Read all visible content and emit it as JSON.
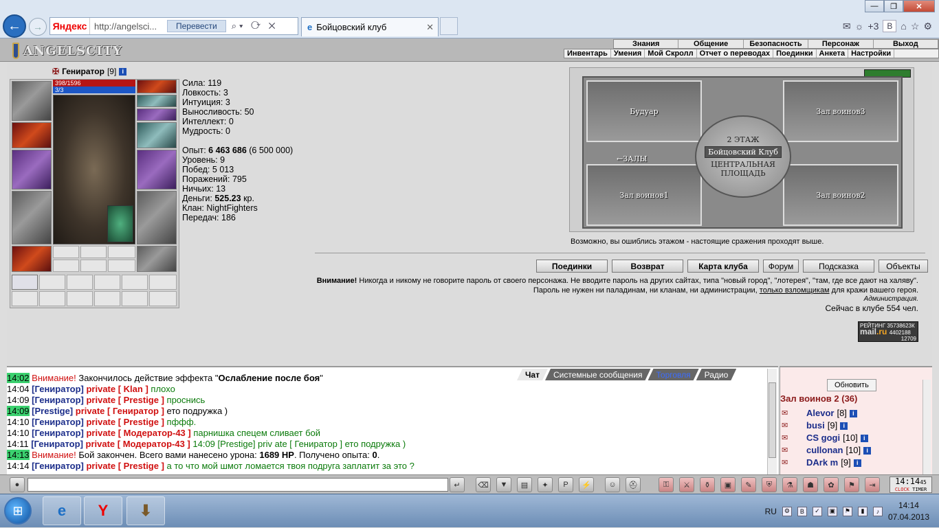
{
  "browser": {
    "search_engine": "Яндекс",
    "url": "http://angelsci...",
    "translate_label": "Перевести",
    "tab_title": "Бойцовский клуб",
    "notify_count": "+3"
  },
  "game": {
    "logo": "ANGELSCITY",
    "main_menu": [
      "Знания",
      "Общение",
      "Безопасность",
      "Персонаж",
      "Выход"
    ],
    "sub_menu": [
      "Инвентарь",
      "Умения",
      "Мой Скролл",
      "Отчет о переводах",
      "Поединки",
      "Анкета",
      "Настройки"
    ]
  },
  "character": {
    "name": "Гениратор",
    "level": "[9]",
    "hp": "398/1596",
    "mp": "3/3",
    "stats": [
      {
        "label": "Сила:",
        "value": "119"
      },
      {
        "label": "Ловкость:",
        "value": "3"
      },
      {
        "label": "Интуиция:",
        "value": "3"
      },
      {
        "label": "Выносливость:",
        "value": "50"
      },
      {
        "label": "Интеллект:",
        "value": "0"
      },
      {
        "label": "Мудрость:",
        "value": "0"
      }
    ],
    "exp_label": "Опыт:",
    "exp_value": "6 463 686",
    "exp_next": "(6 500 000)",
    "details": [
      {
        "label": "Уровень:",
        "value": "9"
      },
      {
        "label": "Побед:",
        "value": "5 013"
      },
      {
        "label": "Поражений:",
        "value": "795"
      },
      {
        "label": "Ничьих:",
        "value": "13"
      }
    ],
    "money_label": "Деньги:",
    "money_value": "525.23",
    "money_unit": "кр.",
    "clan_label": "Клан:",
    "clan_value": "NightFighters",
    "transfers_label": "Передач:",
    "transfers_value": "186"
  },
  "map": {
    "rooms": [
      "Будуар",
      "Зал воинов3",
      "Зал воинов1",
      "Зал воинов2"
    ],
    "hub_floor": "2 ЭТАЖ",
    "hub_club": "Бойцовский Клуб",
    "hub_square": "ЦЕНТРАЛЬНАЯ ПЛОЩАДЬ",
    "halls": "←ЗАЛЫ",
    "hint": "Возможно, вы ошиблись этажом - настоящие сражения проходят выше."
  },
  "actions": [
    "Поединки",
    "Возврат",
    "Карта клуба",
    "Форум",
    "Подсказка",
    "Объекты"
  ],
  "warning": {
    "bold": "Внимание!",
    "text1": " Никогда и никому не говорите пароль от своего персонажа. Не вводите пароль на других сайтах, типа \"новый город\", \"лотерея\", \"там, где все дают на халяву\". Пароль не нужен ни паладинам, ни кланам, ни администрации, ",
    "link": "только взломщикам",
    "text2": " для кражи вашего героя.",
    "admin": "Администрация.",
    "online": "Сейчас в клубе 554 чел."
  },
  "counter": {
    "line1": "РЕЙТИНГ 35738623К",
    "brand_a": "mail",
    "brand_b": ".ru",
    "line2": "4402188",
    "line3": "12709"
  },
  "chat": {
    "tabs": [
      "Чат",
      "Системные сообщения",
      "Торговля",
      "Радио"
    ],
    "messages": [
      {
        "time": "14:02",
        "hl": true,
        "parts": [
          {
            "c": "red",
            "t": "Внимание! "
          },
          {
            "c": "",
            "t": "Закончилось действие эффекта \""
          },
          {
            "c": "b",
            "t": "Ослабление после боя"
          },
          {
            "c": "",
            "t": "\""
          }
        ]
      },
      {
        "time": "14:04",
        "hl": false,
        "parts": [
          {
            "c": "nick",
            "t": "[Гениратор]"
          },
          {
            "c": "priv",
            "t": " private [ Klan ] "
          },
          {
            "c": "green",
            "t": "плохо"
          }
        ]
      },
      {
        "time": "14:09",
        "hl": false,
        "parts": [
          {
            "c": "nick",
            "t": "[Гениратор]"
          },
          {
            "c": "priv",
            "t": " private [ Prestige ] "
          },
          {
            "c": "green",
            "t": "проснись"
          }
        ]
      },
      {
        "time": "14:09",
        "hl": true,
        "parts": [
          {
            "c": "nick",
            "t": "[Prestige]"
          },
          {
            "c": "priv",
            "t": " private [ Гениратор ] "
          },
          {
            "c": "",
            "t": "ето подружка )"
          }
        ]
      },
      {
        "time": "14:10",
        "hl": false,
        "parts": [
          {
            "c": "nick",
            "t": "[Гениратор]"
          },
          {
            "c": "priv",
            "t": " private [ Prestige ] "
          },
          {
            "c": "green",
            "t": "пффф."
          }
        ]
      },
      {
        "time": "14:10",
        "hl": false,
        "parts": [
          {
            "c": "nick",
            "t": "[Гениратор]"
          },
          {
            "c": "priv",
            "t": " private [ Модератор-43 ] "
          },
          {
            "c": "green",
            "t": "парнишка спецем сливает бой"
          }
        ]
      },
      {
        "time": "14:11",
        "hl": false,
        "parts": [
          {
            "c": "nick",
            "t": "[Гениратор]"
          },
          {
            "c": "priv",
            "t": " private [ Модератор-43 ] "
          },
          {
            "c": "green",
            "t": "14:09 [Prestige] priv ate [ Гениратор ] ето подружка )"
          }
        ]
      },
      {
        "time": "14:13",
        "hl": true,
        "parts": [
          {
            "c": "red",
            "t": "Внимание! "
          },
          {
            "c": "",
            "t": "Бой закончен. Всего вами нанесено урона: "
          },
          {
            "c": "b",
            "t": "1689 HP"
          },
          {
            "c": "",
            "t": ". Получено опыта: "
          },
          {
            "c": "b",
            "t": "0"
          },
          {
            "c": "",
            "t": "."
          }
        ]
      },
      {
        "time": "14:14",
        "hl": false,
        "parts": [
          {
            "c": "nick",
            "t": "[Гениратор]"
          },
          {
            "c": "priv",
            "t": " private [ Prestige ] "
          },
          {
            "c": "green",
            "t": "а то что мой шмот ломается твоя подруга заплатит за это ?"
          }
        ]
      }
    ]
  },
  "users": {
    "refresh": "Обновить",
    "room": "Зал воинов 2 (36)",
    "list": [
      {
        "name": "Alevor",
        "level": "[8]"
      },
      {
        "name": "busi",
        "level": "[9]"
      },
      {
        "name": "CS gogi",
        "level": "[10]"
      },
      {
        "name": "cullonan",
        "level": "[10]"
      },
      {
        "name": "DArk m",
        "level": "[9]"
      }
    ]
  },
  "clock": {
    "time": "14:14",
    "sec": "45",
    "l1": "CLOCK",
    "l2": "TIMER"
  },
  "taskbar": {
    "lang": "RU",
    "time": "14:14",
    "date": "07.04.2013"
  }
}
